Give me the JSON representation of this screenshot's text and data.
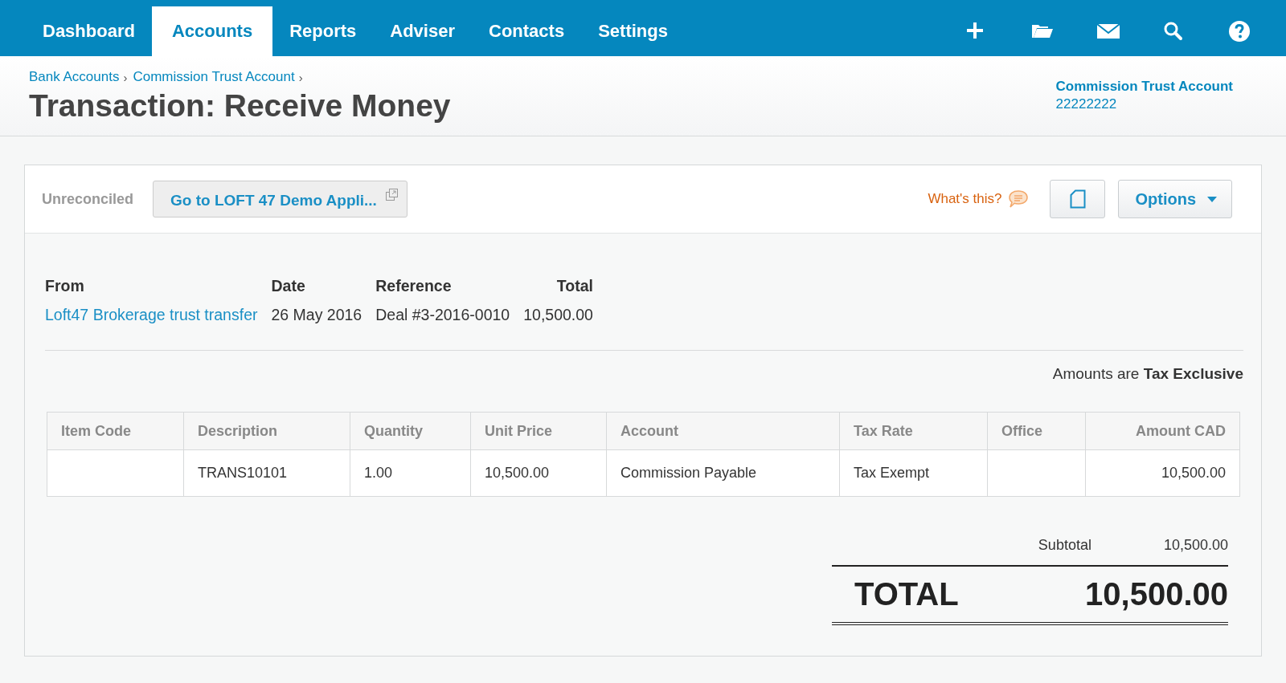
{
  "nav": {
    "tabs": [
      {
        "label": "Dashboard",
        "selected": false
      },
      {
        "label": "Accounts",
        "selected": true
      },
      {
        "label": "Reports",
        "selected": false
      },
      {
        "label": "Adviser",
        "selected": false
      },
      {
        "label": "Contacts",
        "selected": false
      },
      {
        "label": "Settings",
        "selected": false
      }
    ],
    "icons": [
      {
        "kind": "add"
      },
      {
        "kind": "folder"
      },
      {
        "kind": "mail"
      },
      {
        "kind": "search"
      },
      {
        "kind": "help"
      }
    ]
  },
  "header": {
    "breadcrumbs": [
      "Bank Accounts",
      "Commission Trust Account"
    ],
    "separator": "›",
    "title": "Transaction: Receive Money",
    "account_name": "Commission Trust Account",
    "account_number": "22222222"
  },
  "toolbar": {
    "status": "Unreconciled",
    "goto_button": "Go to LOFT 47 Demo Appli...",
    "whats_this": "What's this?",
    "options_button": "Options"
  },
  "summary": {
    "columns": [
      {
        "label": "From",
        "value": "Loft47 Brokerage trust transfer",
        "kind": "link"
      },
      {
        "label": "Date",
        "value": "26 May 2016",
        "kind": "text"
      },
      {
        "label": "Reference",
        "value": "Deal #3-2016-0010",
        "kind": "text"
      },
      {
        "label": "Total",
        "value": "10,500.00",
        "kind": "number"
      }
    ]
  },
  "tax_note": "Amounts are **Tax Exclusive**",
  "table": {
    "columns": [
      {
        "label": "Item Code",
        "kind": "text"
      },
      {
        "label": "Description",
        "kind": "text"
      },
      {
        "label": "Quantity",
        "kind": "text"
      },
      {
        "label": "Unit Price",
        "kind": "text"
      },
      {
        "label": "Account",
        "kind": "text"
      },
      {
        "label": "Tax Rate",
        "kind": "text"
      },
      {
        "label": "Office",
        "kind": "text"
      },
      {
        "label": "Amount CAD",
        "kind": "amount"
      }
    ],
    "rows": [
      [
        "",
        "TRANS10101",
        "1.00",
        "10,500.00",
        "Commission Payable",
        "Tax Exempt",
        "",
        "10,500.00"
      ]
    ]
  },
  "totals": {
    "subtotal_label": "Subtotal",
    "subtotal": "10,500.00",
    "total_label": "TOTAL",
    "total": "10,500.00"
  }
}
